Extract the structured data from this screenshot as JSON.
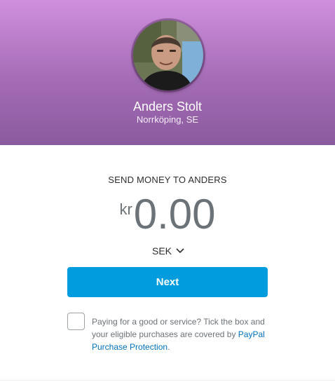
{
  "recipient": {
    "name": "Anders Stolt",
    "location": "Norrköping, SE"
  },
  "send": {
    "title": "SEND MONEY TO ANDERS",
    "currency_symbol": "kr",
    "amount": "0.00",
    "currency_code": "SEK"
  },
  "actions": {
    "next_label": "Next"
  },
  "protection": {
    "text": "Paying for a good or service? Tick the box and your eligible purchases are covered by ",
    "link_text": "PayPal Purchase Protection",
    "suffix": "."
  },
  "icons": {
    "currency_dropdown": "chevron-down-icon",
    "avatar": "profile-photo"
  },
  "colors": {
    "header_top": "#cf8fdc",
    "header_bottom": "#8a5a9e",
    "button": "#009cde",
    "link": "#0070ba"
  }
}
